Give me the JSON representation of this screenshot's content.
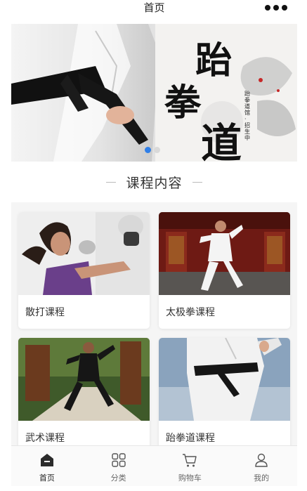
{
  "header": {
    "title": "首页"
  },
  "banner": {
    "slides": 2,
    "active_slide": 1,
    "calligraphy": [
      "跆",
      "拳",
      "道"
    ],
    "caption": "跆拳道馆·招生中"
  },
  "section": {
    "title": "课程内容"
  },
  "courses": [
    {
      "label": "散打课程"
    },
    {
      "label": "太极拳课程"
    },
    {
      "label": "武术课程"
    },
    {
      "label": "跆拳道课程"
    }
  ],
  "tabs": [
    {
      "label": "首页",
      "icon": "home-icon",
      "active": true
    },
    {
      "label": "分类",
      "icon": "grid-icon",
      "active": false
    },
    {
      "label": "购物车",
      "icon": "cart-icon",
      "active": false
    },
    {
      "label": "我的",
      "icon": "user-icon",
      "active": false
    }
  ],
  "colors": {
    "accent": "#2f7fe8",
    "belt": "#111111"
  }
}
